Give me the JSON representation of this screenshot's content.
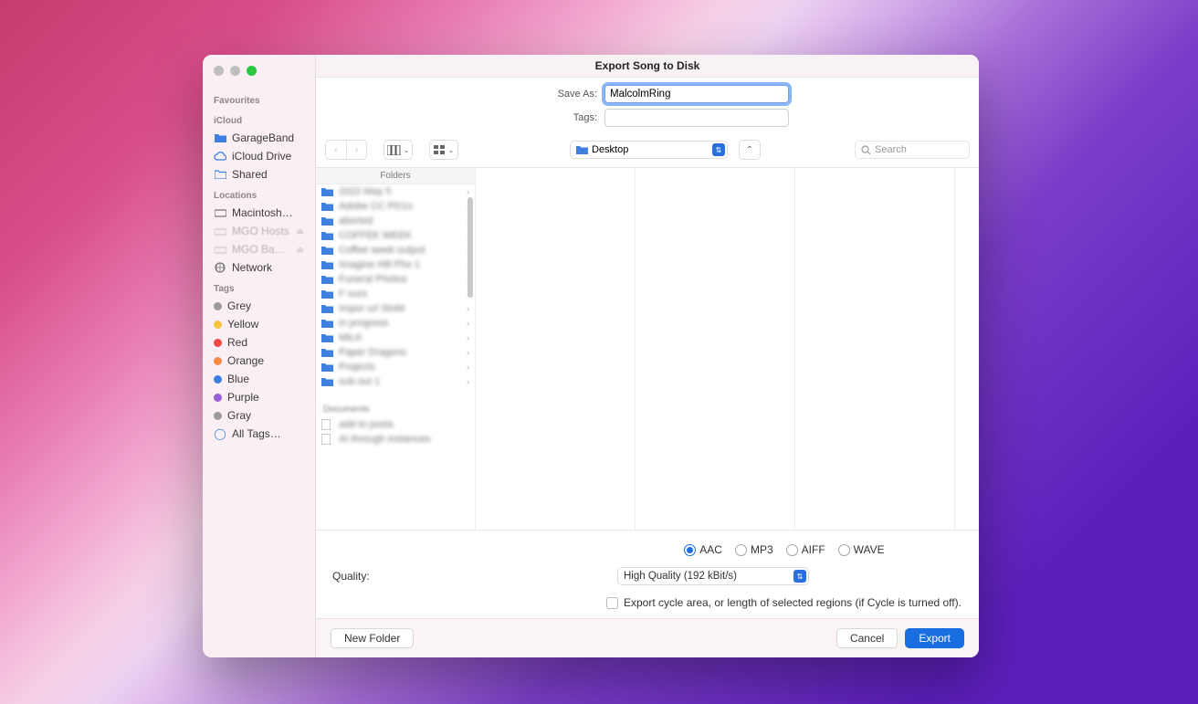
{
  "window": {
    "title": "Export Song to Disk"
  },
  "form": {
    "save_as_label": "Save As:",
    "save_as_value": "MalcolmRing",
    "tags_label": "Tags:",
    "tags_value": ""
  },
  "toolbar": {
    "location": "Desktop",
    "search_placeholder": "Search"
  },
  "sidebar": {
    "favourites_head": "Favourites",
    "icloud_head": "iCloud",
    "icloud_items": [
      {
        "label": "GarageBand",
        "icon": "folder-icon"
      },
      {
        "label": "iCloud Drive",
        "icon": "cloud-icon"
      },
      {
        "label": "Shared",
        "icon": "shared-folder-icon"
      }
    ],
    "locations_head": "Locations",
    "locations_items": [
      {
        "label": "Macintosh…",
        "icon": "disk-icon"
      },
      {
        "label": "MGO Hosts",
        "icon": "drive-icon",
        "dim": true
      },
      {
        "label": "MGO Ba…",
        "icon": "drive-icon",
        "dim": true
      },
      {
        "label": "Network",
        "icon": "globe-icon"
      }
    ],
    "tags_head": "Tags",
    "tags": [
      {
        "label": "Grey",
        "color": "#9a9a9a"
      },
      {
        "label": "Yellow",
        "color": "#f5c542"
      },
      {
        "label": "Red",
        "color": "#f04747"
      },
      {
        "label": "Orange",
        "color": "#f58b42"
      },
      {
        "label": "Blue",
        "color": "#3e7fe2"
      },
      {
        "label": "Purple",
        "color": "#9a60d8"
      },
      {
        "label": "Gray",
        "color": "#9a9a9a"
      }
    ],
    "all_tags_label": "All Tags…"
  },
  "browser": {
    "col_head": "Folders",
    "folder_items": [
      "2022 May 5",
      "Adobe CC PD1s",
      "aborted",
      "COFFEE WEEK",
      "Coffee week output",
      "Imagine Hill Pho 1",
      "Funeral Photos",
      "F ours",
      "Impor url StoM",
      "in progress",
      "MILK",
      "Paper Dragons",
      "Projects",
      "sub out 1"
    ],
    "documents_head": "Documents",
    "doc_items": [
      "add to posts",
      "AI through instances"
    ]
  },
  "options": {
    "formats": [
      "AAC",
      "MP3",
      "AIFF",
      "WAVE"
    ],
    "format_selected": "AAC",
    "quality_label": "Quality:",
    "quality_value": "High Quality (192 kBit/s)",
    "cycle_label": "Export cycle area, or length of selected regions (if Cycle is turned off)."
  },
  "footer": {
    "new_folder": "New Folder",
    "cancel": "Cancel",
    "export": "Export"
  }
}
